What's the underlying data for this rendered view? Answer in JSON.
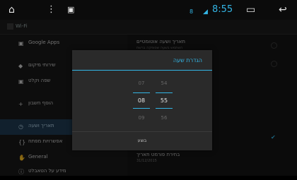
{
  "statusbar": {
    "time": "8:55",
    "signal_glyph": "◢",
    "notification_glyph": "8"
  },
  "action_bar": {
    "title": "Wi-Fi"
  },
  "left_list": [
    {
      "label": "Google Apps",
      "icon": "google-apps-icon"
    },
    {
      "label": "שירותי מיקום",
      "icon": "location-icon"
    },
    {
      "label": "שפה וקלט",
      "icon": "language-icon"
    },
    {
      "label": "הוסף חשבון",
      "icon": "add-icon"
    },
    {
      "label": "תאריך ושעה",
      "icon": "clock-icon",
      "selected": true
    },
    {
      "label": "אפשרויות מפתח",
      "icon": "developer-icon"
    },
    {
      "label": "General",
      "icon": "hand-icon"
    },
    {
      "label": "מידע על הטאבלט",
      "icon": "info-icon"
    }
  ],
  "right_list": {
    "auto_title": "תאריך ושעה אוטומטיים",
    "auto_sub": "השתמש בשעה שסופקה ברשת",
    "format_title": "בחירת פורמט תאריך",
    "format_sub": "31/12/2015"
  },
  "dialog": {
    "title": "הגדרת שעה",
    "hours": {
      "prev": "07",
      "current": "08",
      "next": "09"
    },
    "minutes": {
      "prev": "54",
      "current": "55",
      "next": "56"
    },
    "ok_label": "בוצע"
  },
  "colors": {
    "accent": "#33b5e5",
    "selected_row": "#1f3b52"
  }
}
